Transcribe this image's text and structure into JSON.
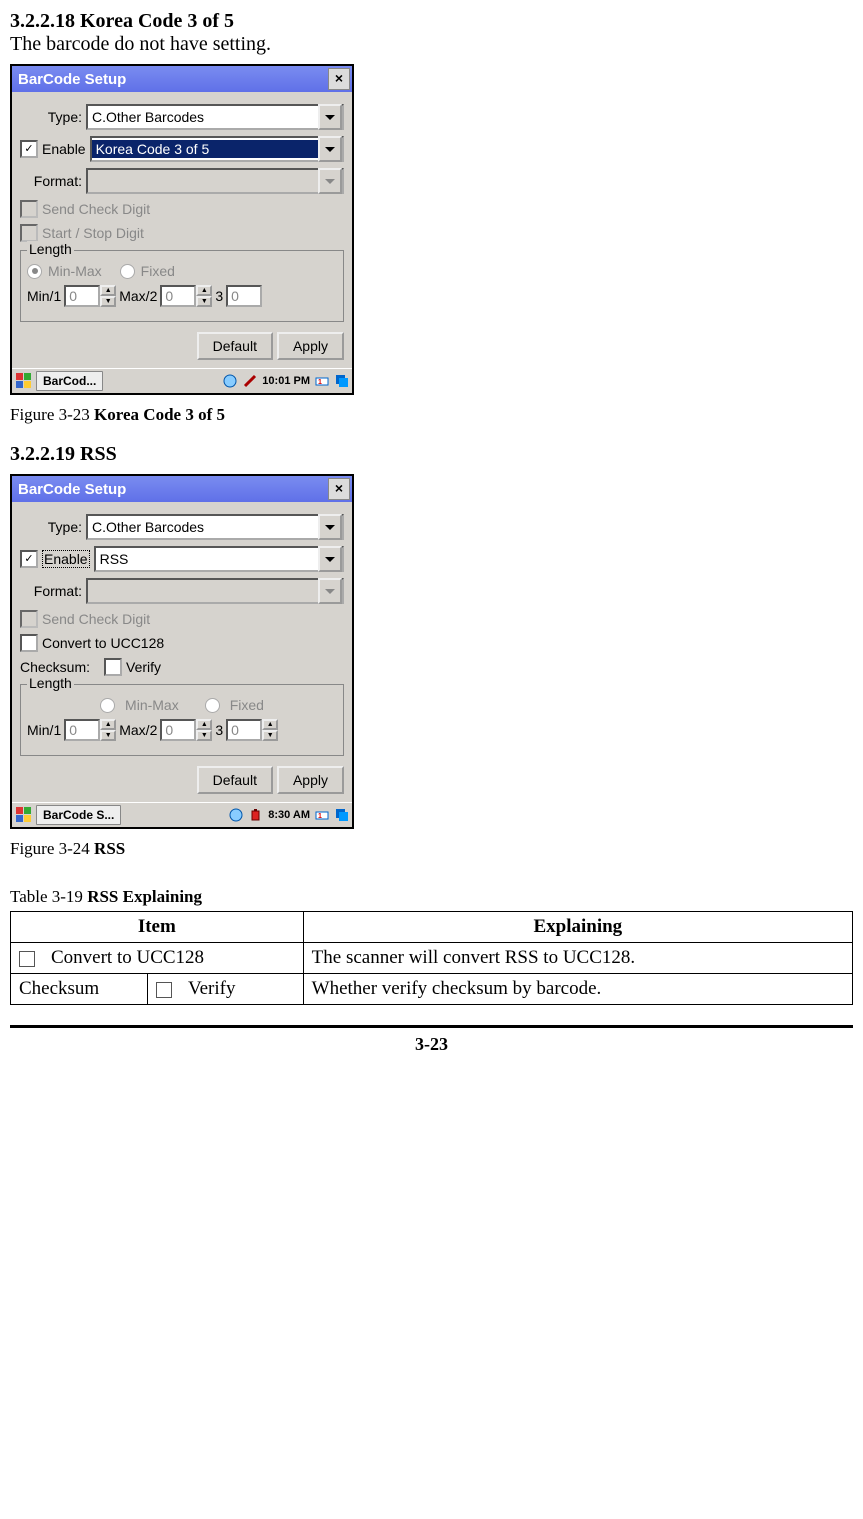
{
  "section1": {
    "heading": "3.2.2.18 Korea Code 3 of 5",
    "body": "The barcode do not have setting.",
    "fig_caption_prefix": "Figure 3-23 ",
    "fig_caption_bold": "Korea Code 3 of 5"
  },
  "dialog1": {
    "title": "BarCode Setup",
    "type_label": "Type:",
    "type_value": "C.Other Barcodes",
    "enable_label": "Enable",
    "enable_value": "Korea Code 3 of 5",
    "format_label": "Format:",
    "send_check": "Send Check Digit",
    "start_stop": "Start / Stop Digit",
    "length_label": "Length",
    "minmax_label": "Min-Max",
    "fixed_label": "Fixed",
    "min1_label": "Min/1",
    "max2_label": "Max/2",
    "three_label": "3",
    "min1_val": "0",
    "max2_val": "0",
    "three_val": "0",
    "default_btn": "Default",
    "apply_btn": "Apply",
    "task_label": "BarCod...",
    "clock": "10:01 PM"
  },
  "section2": {
    "heading": "3.2.2.19 RSS",
    "fig_caption_prefix": "Figure 3-24 ",
    "fig_caption_bold": "RSS",
    "table_caption_prefix": "Table 3-19 ",
    "table_caption_bold": "RSS Explaining"
  },
  "dialog2": {
    "title": "BarCode Setup",
    "type_label": "Type:",
    "type_value": "C.Other Barcodes",
    "enable_label": "Enable",
    "enable_value": "RSS",
    "format_label": "Format:",
    "send_check": "Send Check Digit",
    "convert_ucc": "Convert to UCC128",
    "checksum_label": "Checksum:",
    "verify_label": "Verify",
    "length_label": "Length",
    "minmax_label": "Min-Max",
    "fixed_label": "Fixed",
    "min1_label": "Min/1",
    "max2_label": "Max/2",
    "three_label": "3",
    "min1_val": "0",
    "max2_val": "0",
    "three_val": "0",
    "default_btn": "Default",
    "apply_btn": "Apply",
    "task_label": "BarCode S...",
    "clock": "8:30 AM"
  },
  "table": {
    "header_item": "Item",
    "header_expl": "Explaining",
    "row1_item": "Convert to UCC128",
    "row1_expl": "The scanner will convert RSS to UCC128.",
    "row2_left": "Checksum",
    "row2_mid": "Verify",
    "row2_expl": "Whether verify checksum by barcode."
  },
  "page_number": "3-23"
}
